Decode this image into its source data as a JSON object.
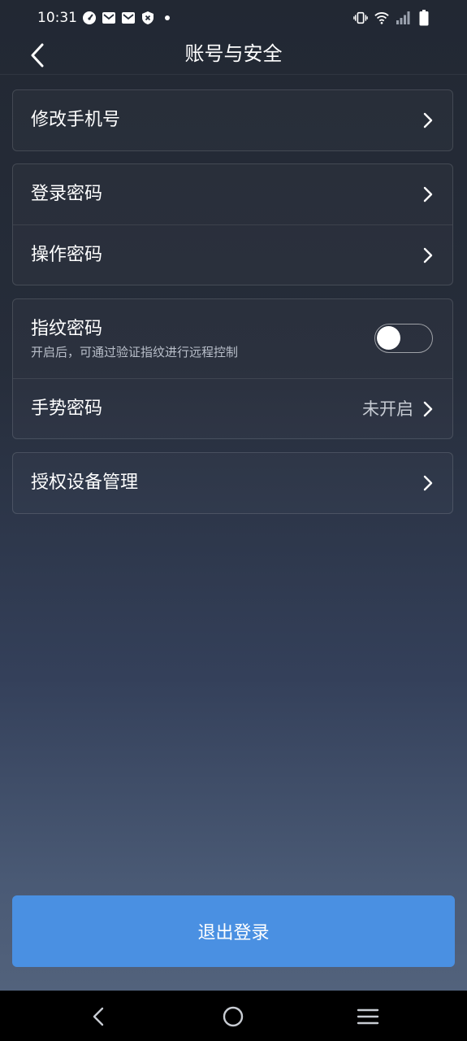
{
  "status_bar": {
    "time": "10:31",
    "left_icons": [
      "speedometer-icon",
      "mail-icon",
      "mail-icon",
      "shield-x-icon"
    ],
    "right_icons": [
      "vibrate-icon",
      "wifi-icon",
      "signal-icon",
      "battery-icon"
    ]
  },
  "header": {
    "title": "账号与安全"
  },
  "sections": [
    {
      "rows": [
        {
          "id": "change-phone",
          "label": "修改手机号"
        }
      ]
    },
    {
      "rows": [
        {
          "id": "login-password",
          "label": "登录密码"
        },
        {
          "id": "operation-password",
          "label": "操作密码"
        }
      ]
    },
    {
      "rows": [
        {
          "id": "fingerprint-password",
          "label": "指纹密码",
          "subtitle": "开启后，可通过验证指纹进行远程控制",
          "toggle_on": false
        },
        {
          "id": "gesture-password",
          "label": "手势密码",
          "value": "未开启"
        }
      ]
    },
    {
      "rows": [
        {
          "id": "authorized-devices",
          "label": "授权设备管理"
        }
      ]
    }
  ],
  "logout_label": "退出登录",
  "colors": {
    "accent": "#4a90e2",
    "background_top": "#222833",
    "background_bottom": "#56667f"
  }
}
